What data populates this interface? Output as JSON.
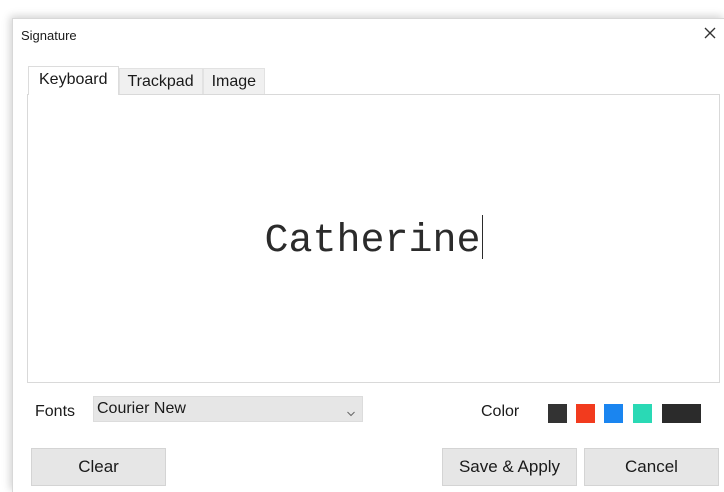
{
  "window": {
    "title": "Signature",
    "close_icon": "close-icon"
  },
  "tabs": [
    {
      "label": "Keyboard",
      "active": true
    },
    {
      "label": "Trackpad",
      "active": false
    },
    {
      "label": "Image",
      "active": false
    }
  ],
  "signature": {
    "text": "Catherine"
  },
  "fonts": {
    "label": "Fonts",
    "selected": "Courier New"
  },
  "color": {
    "label": "Color",
    "swatches": [
      "#333333",
      "#f23b1e",
      "#1a85f0",
      "#2ad9b5",
      "#2b2b2b"
    ]
  },
  "buttons": {
    "clear": "Clear",
    "save_apply": "Save & Apply",
    "cancel": "Cancel"
  }
}
